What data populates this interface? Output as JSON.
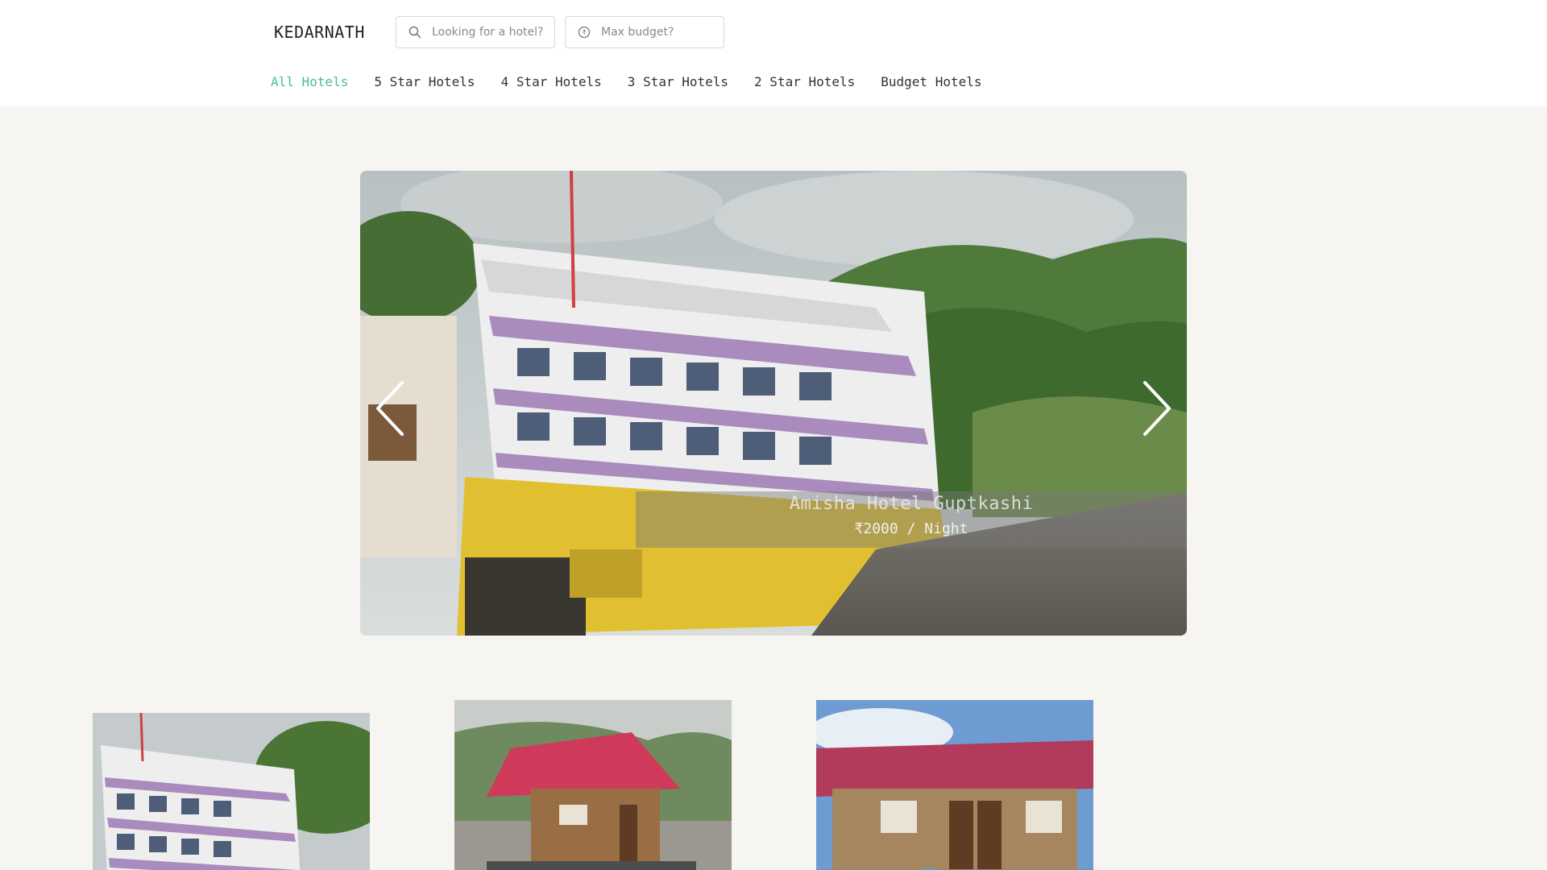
{
  "header": {
    "brand": "KEDARNATH",
    "search": {
      "hotel_placeholder": "Looking for a hotel?",
      "budget_placeholder": "Max budget?",
      "hotel_icon": "search-icon",
      "budget_icon": "currency-icon"
    }
  },
  "nav": {
    "items": [
      {
        "label": "All Hotels",
        "active": true
      },
      {
        "label": "5 Star Hotels",
        "active": false
      },
      {
        "label": "4 Star Hotels",
        "active": false
      },
      {
        "label": "3 Star Hotels",
        "active": false
      },
      {
        "label": "2 Star Hotels",
        "active": false
      },
      {
        "label": "Budget Hotels",
        "active": false
      }
    ],
    "active_color": "#48c38a"
  },
  "carousel": {
    "hotel_name": "Amisha Hotel Guptkashi",
    "price": "₹2000 / Night",
    "prev_icon": "chevron-left-icon",
    "next_icon": "chevron-right-icon"
  },
  "thumbnails": [
    {
      "image": "multi-storey-white-hotel-photo"
    },
    {
      "image": "wooden-hut-red-roof-photo"
    },
    {
      "image": "cottage-red-roof-photo"
    }
  ]
}
